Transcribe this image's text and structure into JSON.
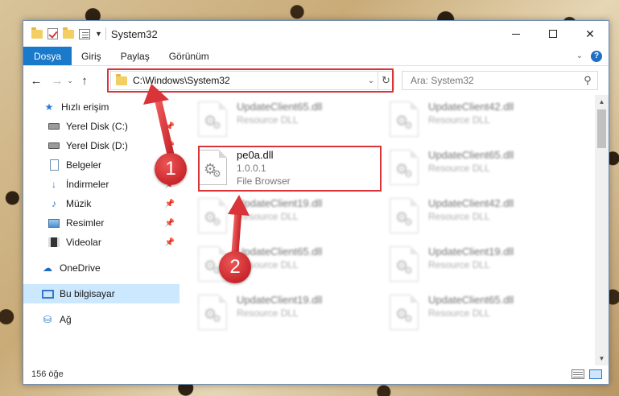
{
  "window": {
    "title": "System32",
    "status_count": "156 öğe"
  },
  "ribbon": {
    "tabs": [
      "Dosya",
      "Giriş",
      "Paylaş",
      "Görünüm"
    ]
  },
  "nav": {
    "address": "C:\\Windows\\System32",
    "search_placeholder": "Ara: System32"
  },
  "sidebar": {
    "items": [
      {
        "label": "Hızlı erişim",
        "icon": "star-icon"
      },
      {
        "label": "Yerel Disk (C:)",
        "icon": "drive-icon",
        "pinned": true
      },
      {
        "label": "Yerel Disk (D:)",
        "icon": "drive-icon",
        "pinned": true
      },
      {
        "label": "Belgeler",
        "icon": "document-icon",
        "pinned": true
      },
      {
        "label": "İndirmeler",
        "icon": "download-icon",
        "pinned": true
      },
      {
        "label": "Müzik",
        "icon": "music-icon",
        "pinned": true
      },
      {
        "label": "Resimler",
        "icon": "pictures-icon",
        "pinned": true
      },
      {
        "label": "Videolar",
        "icon": "video-icon",
        "pinned": true
      },
      {
        "label": "OneDrive",
        "icon": "cloud-icon"
      },
      {
        "label": "Bu bilgisayar",
        "icon": "computer-icon",
        "selected": true
      },
      {
        "label": "Ağ",
        "icon": "network-icon"
      }
    ]
  },
  "files": {
    "highlighted": {
      "name": "pe0a.dll",
      "version": "1.0.0.1",
      "description": "File Browser"
    },
    "blurred": [
      {
        "name": "UpdateClient65.dll",
        "description": "Resource DLL"
      },
      {
        "name": "UpdateClient42.dll",
        "description": "Resource DLL"
      },
      {
        "name": "UpdateClient65.dll",
        "description": "Resource DLL"
      },
      {
        "name": "UpdateClient19.dll",
        "description": "Resource DLL"
      },
      {
        "name": "UpdateClient42.dll",
        "description": "Resource DLL"
      },
      {
        "name": "UpdateClient65.dll",
        "description": "Resource DLL"
      },
      {
        "name": "UpdateClient19.dll",
        "description": "Resource DLL"
      },
      {
        "name": "UpdateClient19.dll",
        "description": "Resource DLL"
      },
      {
        "name": "UpdateClient65.dll",
        "description": "Resource DLL"
      }
    ]
  },
  "callouts": {
    "step1": "1",
    "step2": "2",
    "color": "#d9343a"
  }
}
